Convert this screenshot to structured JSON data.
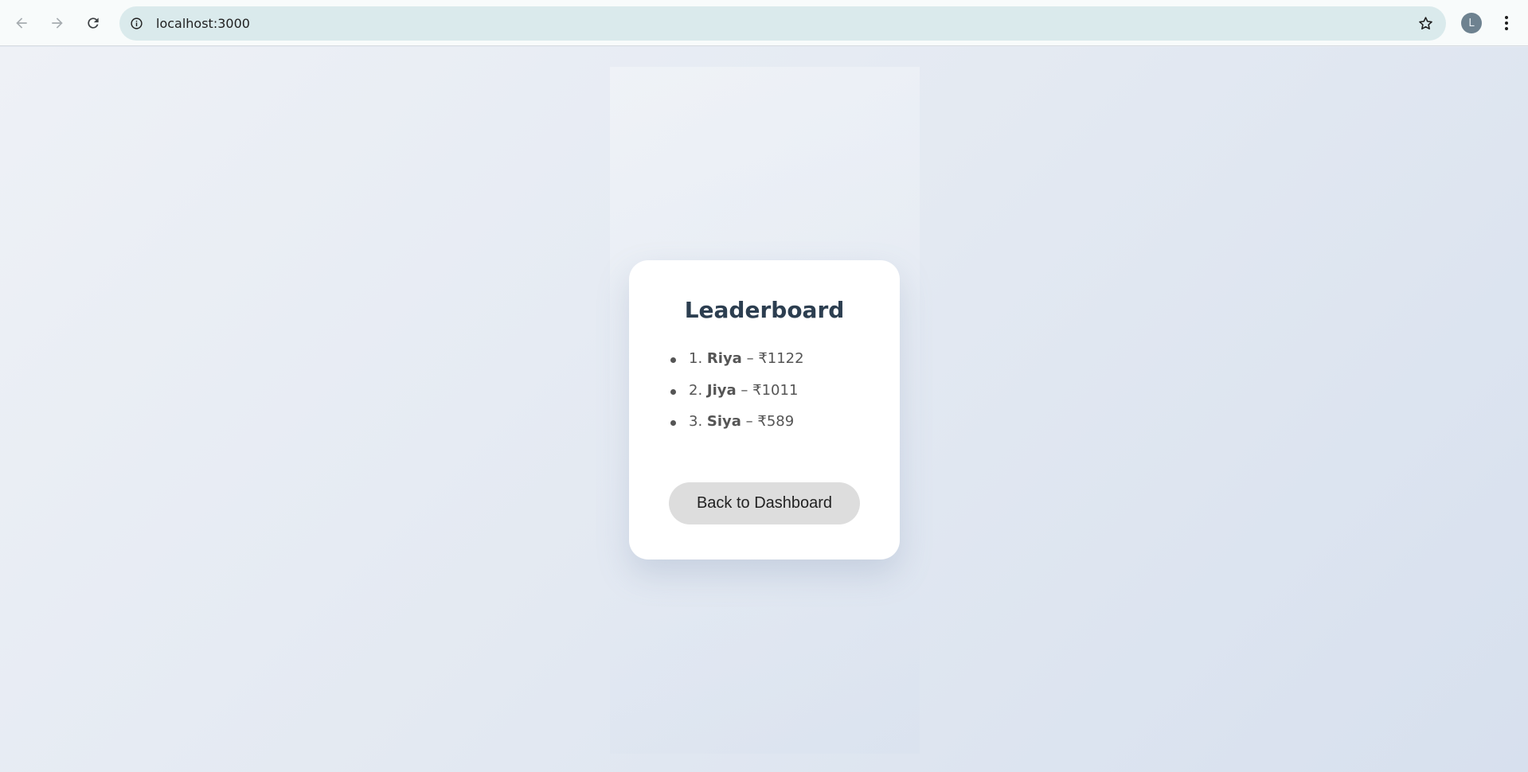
{
  "browser": {
    "url": "localhost:3000",
    "profile_initial": "L",
    "icons": {
      "back": "arrow-left-icon",
      "forward": "arrow-right-icon",
      "reload": "reload-icon",
      "site_info": "info-icon",
      "bookmark": "star-icon",
      "menu": "kebab-menu-icon"
    }
  },
  "leaderboard": {
    "title": "Leaderboard",
    "entries": [
      {
        "rank": "1.",
        "name": "Riya",
        "separator": "–",
        "amount": "₹1122"
      },
      {
        "rank": "2.",
        "name": "Jiya",
        "separator": "–",
        "amount": "₹1011"
      },
      {
        "rank": "3.",
        "name": "Siya",
        "separator": "–",
        "amount": "₹589"
      }
    ],
    "back_button_label": "Back to Dashboard"
  },
  "colors": {
    "title": "#2c3e50",
    "text": "#555555",
    "button_bg": "#dddddd",
    "omnibox_bg": "#daeaec",
    "avatar_bg": "#6e8290"
  }
}
